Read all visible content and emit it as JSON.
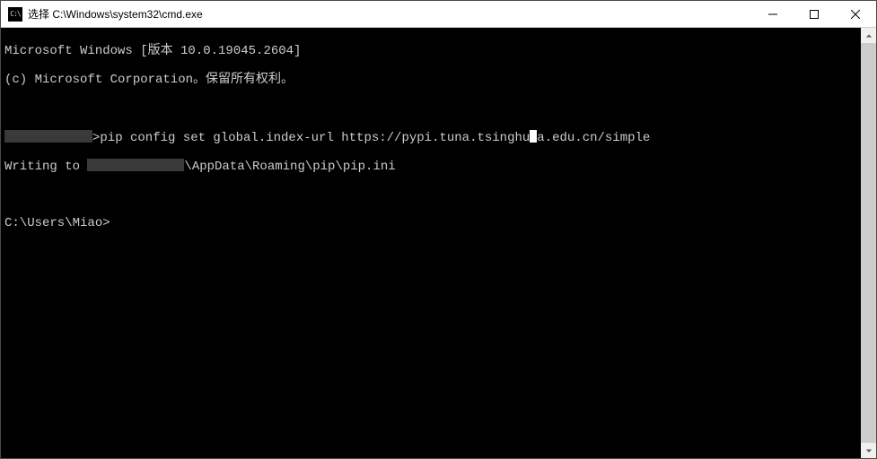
{
  "titlebar": {
    "icon_text": "C:\\",
    "title": "选择 C:\\Windows\\system32\\cmd.exe"
  },
  "controls": {
    "minimize_name": "minimize",
    "maximize_name": "maximize",
    "close_name": "close"
  },
  "terminal": {
    "line1": "Microsoft Windows [版本 10.0.19045.2604]",
    "line2": "(c) Microsoft Corporation。保留所有权利。",
    "cmd1_prefix_hidden_width": 98,
    "cmd1_after_hidden": ">pip config set global.index-url https://pypi.tuna.tsinghu",
    "cmd1_tail": "a.edu.cn/simple",
    "out1_prefix": "Writing to ",
    "out1_hidden_width": 108,
    "out1_after_hidden": "\\AppData\\Roaming\\pip\\pip.ini",
    "prompt2": "C:\\Users\\Miao>"
  }
}
